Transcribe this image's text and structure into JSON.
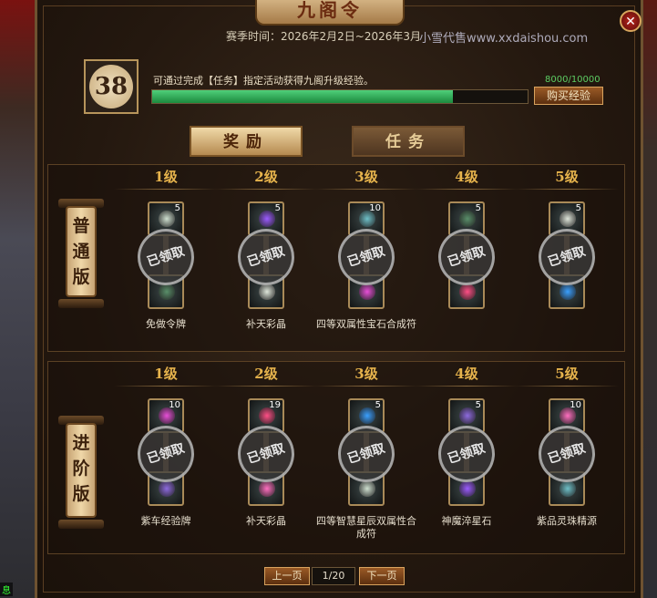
{
  "window": {
    "title": "九阁令",
    "close_glyph": "✕"
  },
  "header": {
    "season_time": "赛季时间：2026年2月2日~2026年3月",
    "watermark": "小雪代售www.xxdaishou.com",
    "level": "38",
    "description": "可通过完成【任务】指定活动获得九阁升级经验。",
    "exp_text": "8000/10000",
    "exp_progress": 0.8,
    "buy_button": "购买经验"
  },
  "tabs": [
    {
      "label": "奖励",
      "active": true
    },
    {
      "label": "任务",
      "active": false
    }
  ],
  "level_headers": [
    "1级",
    "2级",
    "3级",
    "4级",
    "5级"
  ],
  "claimed_text": "已领取",
  "tracks": [
    {
      "label": "普通版",
      "items": [
        {
          "top_qty": "5",
          "name": "免做令牌"
        },
        {
          "top_qty": "5",
          "name": "补天彩晶"
        },
        {
          "top_qty": "10",
          "name": "四等双属性宝石合成符"
        },
        {
          "top_qty": "5",
          "name": ""
        },
        {
          "top_qty": "5",
          "name": ""
        }
      ]
    },
    {
      "label": "进阶版",
      "items": [
        {
          "top_qty": "10",
          "name": "紫车经验牌"
        },
        {
          "top_qty": "19",
          "name": "补天彩晶"
        },
        {
          "top_qty": "5",
          "name": "四等智慧星辰双属性合成符"
        },
        {
          "top_qty": "5",
          "name": "神魔淬星石"
        },
        {
          "top_qty": "10",
          "name": "紫品灵珠精源"
        }
      ]
    }
  ],
  "pager": {
    "prev": "上一页",
    "page": "1/20",
    "next": "下一页"
  },
  "chat_tag": "息"
}
